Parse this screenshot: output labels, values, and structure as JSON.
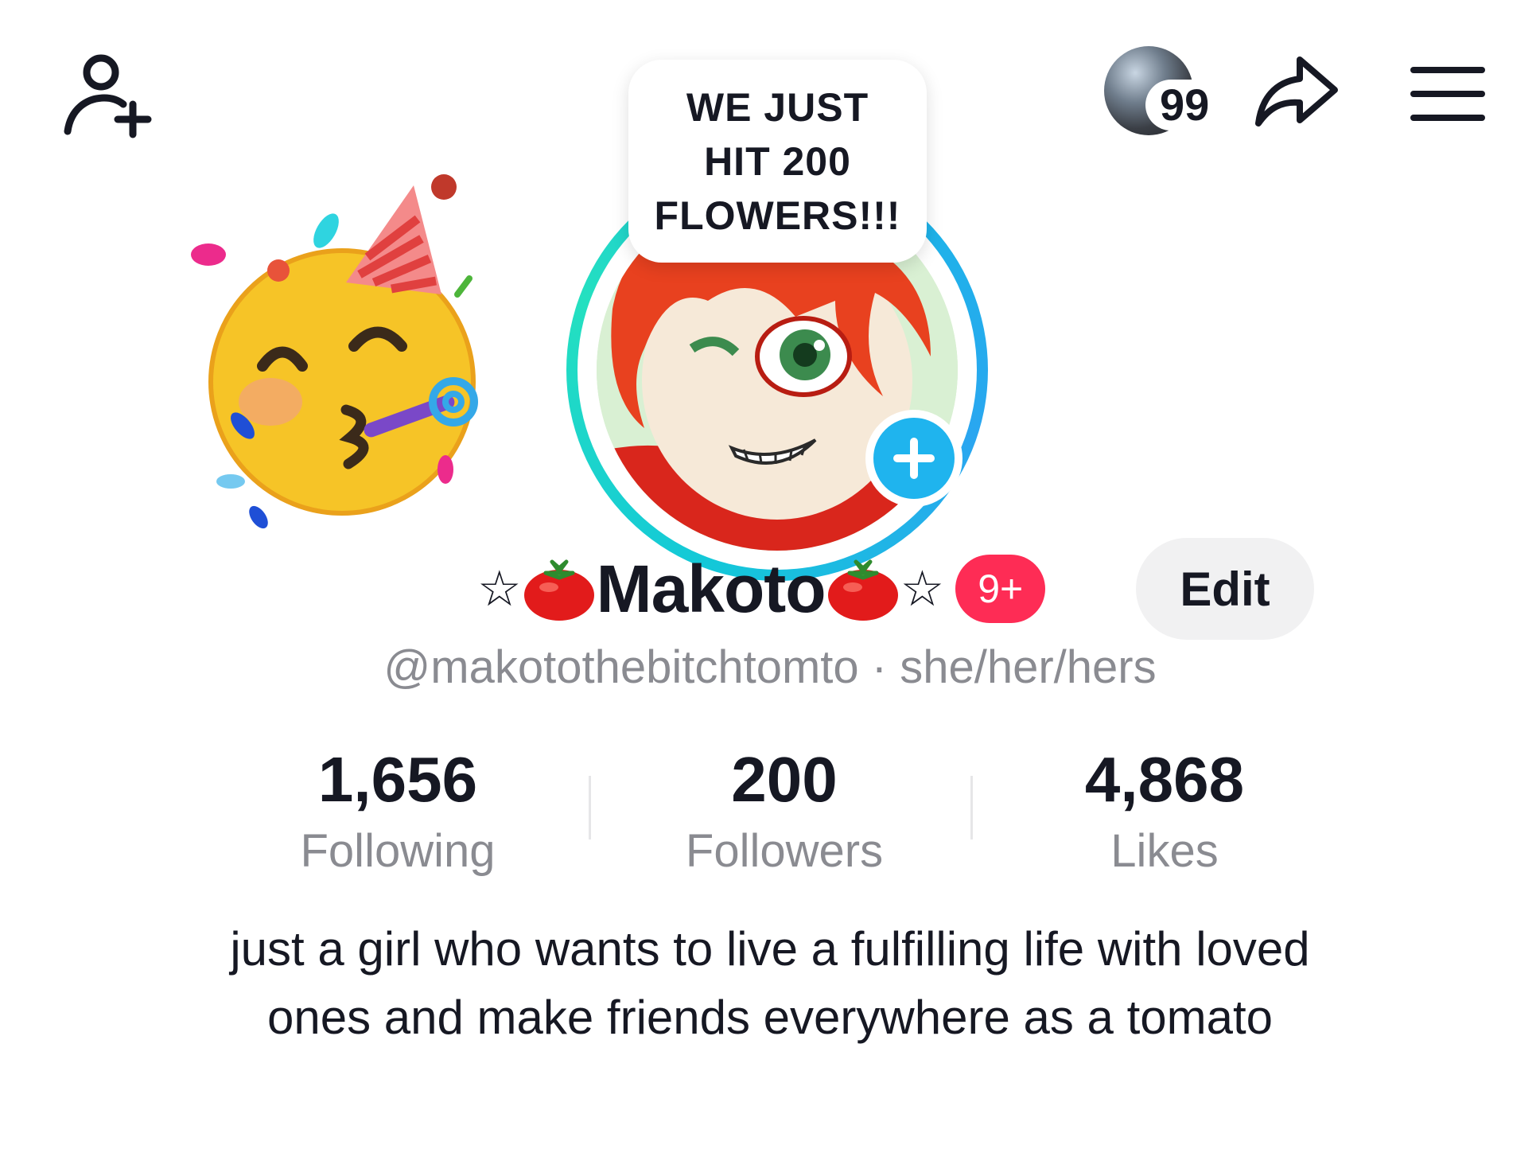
{
  "header": {
    "add_friend_icon": "person-add-icon",
    "viewer_count": "99",
    "share_icon": "share-arrow-icon",
    "menu_icon": "hamburger-menu-icon"
  },
  "bubble": {
    "text": "WE JUST\nHIT 200\nFLOWERS!!!"
  },
  "profile": {
    "star_left": "☆",
    "name": "Makoto",
    "star_right": "☆",
    "notification_badge": "9+",
    "edit_label": "Edit",
    "handle": "@makotothebitchtomto",
    "separator": " · ",
    "pronouns": "she/her/hers"
  },
  "stats": [
    {
      "value": "1,656",
      "label": "Following"
    },
    {
      "value": "200",
      "label": "Followers"
    },
    {
      "value": "4,868",
      "label": "Likes"
    }
  ],
  "bio": "just a girl who wants to live a fulfilling life with loved ones and make friends everywhere as a tomato",
  "colors": {
    "accent_red": "#fe2c55",
    "plus_blue": "#1fb4ee",
    "ring_cyan": "#13c8d8",
    "muted_text": "#8a8b91"
  }
}
